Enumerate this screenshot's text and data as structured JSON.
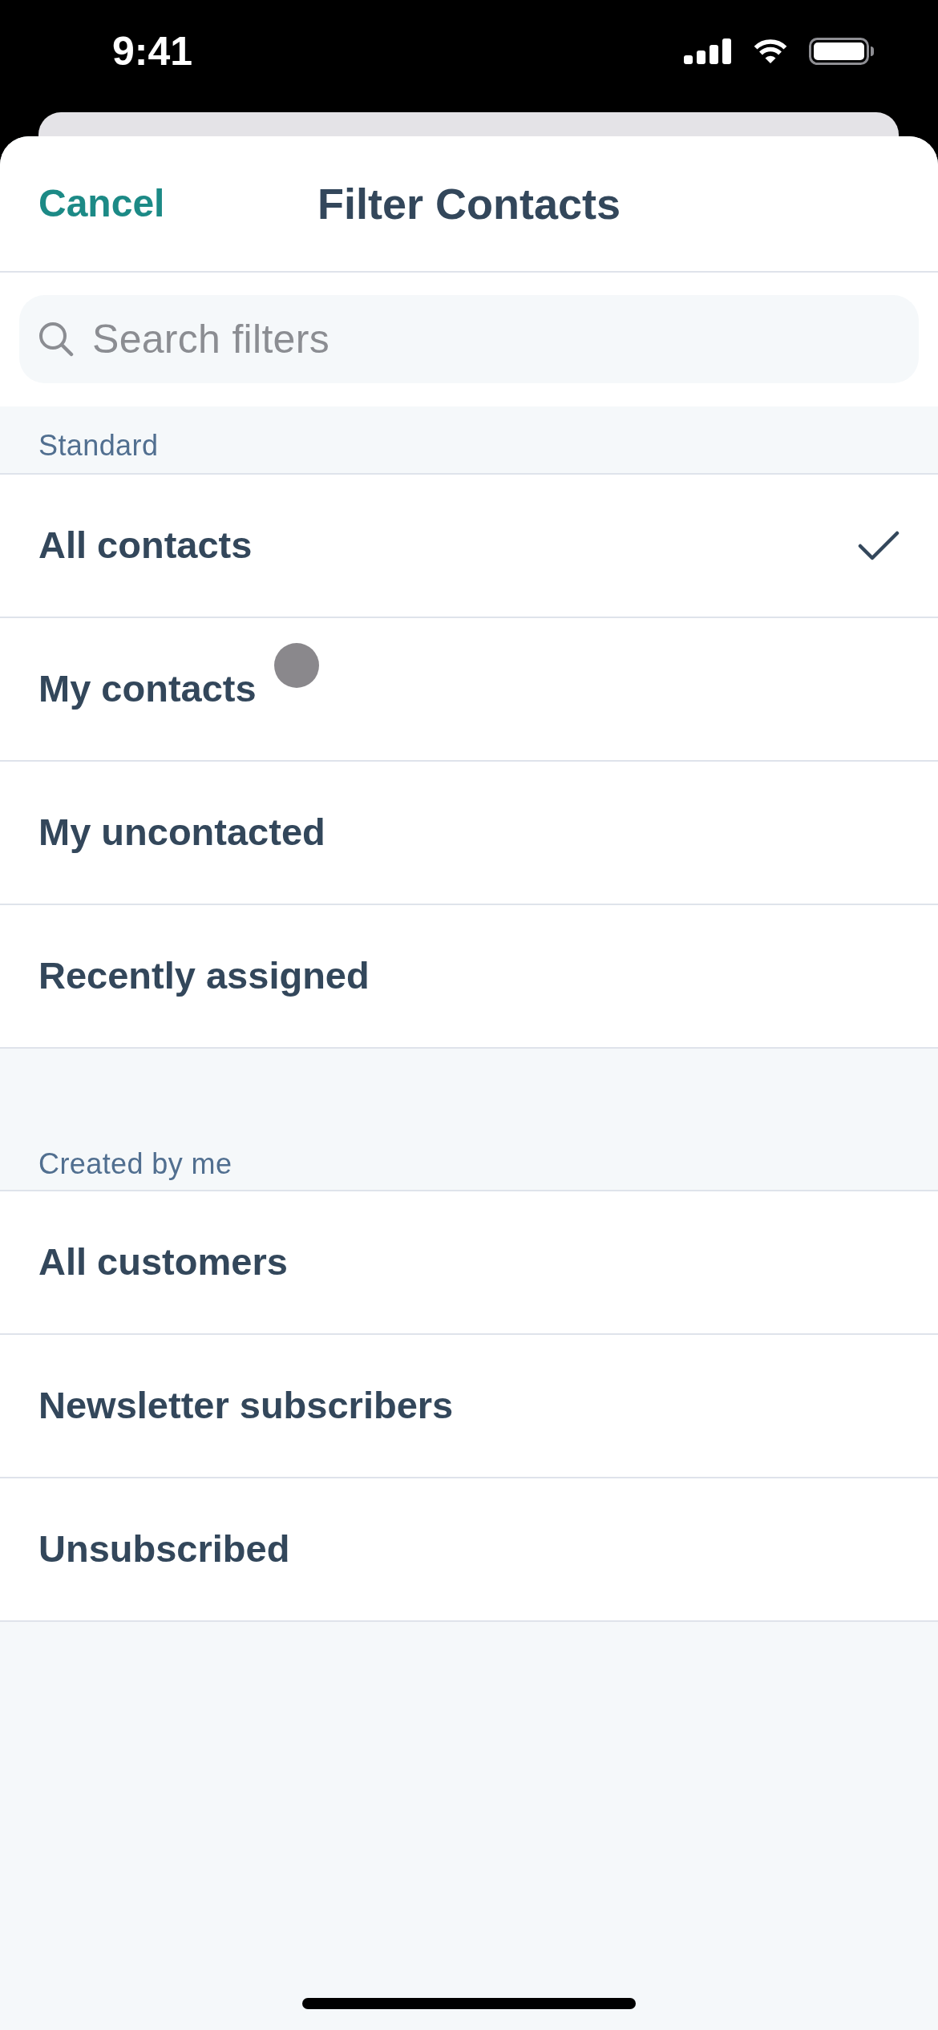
{
  "status_bar": {
    "time": "9:41"
  },
  "header": {
    "cancel": "Cancel",
    "title": "Filter Contacts"
  },
  "search": {
    "placeholder": "Search filters"
  },
  "sections": [
    {
      "title": "Standard",
      "items": [
        {
          "label": "All contacts",
          "selected": true,
          "touch_point": false
        },
        {
          "label": "My contacts",
          "selected": false,
          "touch_point": true
        },
        {
          "label": "My uncontacted",
          "selected": false,
          "touch_point": false
        },
        {
          "label": "Recently assigned",
          "selected": false,
          "touch_point": false
        }
      ]
    },
    {
      "title": "Created by me",
      "items": [
        {
          "label": "All customers",
          "selected": false,
          "touch_point": false
        },
        {
          "label": "Newsletter subscribers",
          "selected": false,
          "touch_point": false
        },
        {
          "label": "Unsubscribed",
          "selected": false,
          "touch_point": false
        }
      ]
    }
  ]
}
